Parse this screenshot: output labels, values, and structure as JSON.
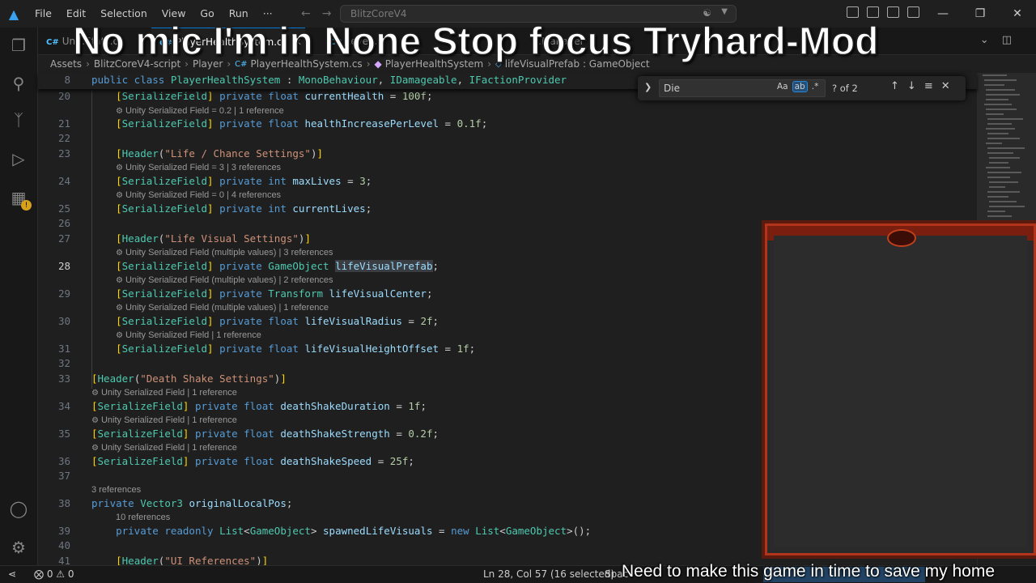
{
  "titlebar": {
    "menu": [
      "File",
      "Edit",
      "Selection",
      "View",
      "Go",
      "Run",
      "···"
    ],
    "search_text": "BlitzCoreV4"
  },
  "tabs": [
    {
      "label": "Un…Stats.cs",
      "active": false
    },
    {
      "label": "PlayerHealthSystem.cs",
      "active": true
    },
    {
      "label": "Level…",
      "active": false
    },
    {
      "label": "…Manager",
      "active": false
    }
  ],
  "breadcrumb": [
    "Assets",
    "BlitzCoreV4-script",
    "Player",
    "PlayerHealthSystem.cs",
    "PlayerHealthSystem",
    "lifeVisualPrefab : GameObject"
  ],
  "find": {
    "query": "Die",
    "opt_case": "Aa",
    "opt_word": "ab",
    "opt_regex": ".*",
    "count": "? of 2"
  },
  "sticky_line": {
    "number": "8",
    "text": "public class PlayerHealthSystem : MonoBehaviour, IDamageable, IFactionProvider"
  },
  "lenses": {
    "l20": "Unity Serialized Field = 0.2 | 1 reference",
    "l24": "Unity Serialized Field = 3 | 3 references",
    "l25": "Unity Serialized Field = 0 | 4 references",
    "l28": "Unity Serialized Field (multiple values) | 3 references",
    "l29": "Unity Serialized Field (multiple values) | 2 references",
    "l30": "Unity Serialized Field (multiple values) | 1 reference",
    "l31": "Unity Serialized Field | 1 reference",
    "l34": "Unity Serialized Field | 1 reference",
    "l35": "Unity Serialized Field | 1 reference",
    "l36": "Unity Serialized Field | 1 reference",
    "l38": "3 references",
    "l39": "10 references"
  },
  "line_numbers": [
    "20",
    "21",
    "22",
    "23",
    "24",
    "25",
    "26",
    "27",
    "28",
    "29",
    "30",
    "31",
    "32",
    "33",
    "34",
    "35",
    "36",
    "37",
    "38",
    "39",
    "40",
    "41"
  ],
  "status": {
    "problems": "0",
    "warnings": "0",
    "position": "Ln 28, Col 57 (16 selected)",
    "spaces": "Spac"
  },
  "overlay": {
    "title": "No mic I'm in None Stop focus Tryhard-Mod",
    "subtitle": "Need to make this game in time to save my home"
  }
}
